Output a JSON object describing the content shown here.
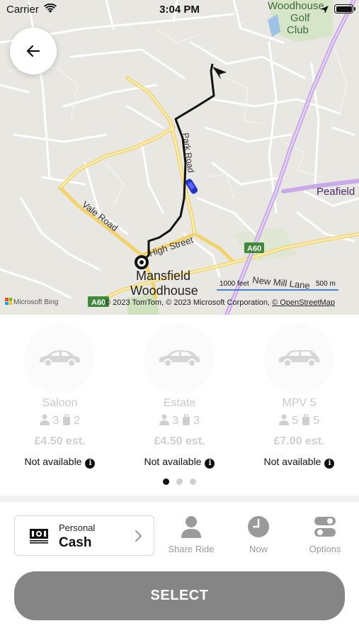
{
  "status_bar": {
    "carrier": "Carrier",
    "time": "3:04 PM"
  },
  "map": {
    "labels": {
      "golf_club_line1": "Woodhouse",
      "golf_club_line2": "Golf",
      "golf_club_line3": "Club",
      "peafield": "Peafield",
      "vale_road": "Vale Road",
      "high_street": "High Street",
      "park_road": "Park Road",
      "a60_upper": "A60",
      "a60_lower": "A60",
      "town_line1": "Mansfield",
      "town_line2": "Woodhouse",
      "new_mill_lane": "New Mill Lane"
    },
    "scale_feet": "1000 feet",
    "scale_meters": "500 m",
    "bing": "Microsoft Bing",
    "attribution_main": "© 2023 TomTom, © 2023 Microsoft Corporation, ",
    "attribution_osm": "© OpenStreetMap",
    "colors": {
      "route": "#111111",
      "main_road": "#f2d36b",
      "highway": "#c9a9e8",
      "driver": "#2233cc"
    }
  },
  "vehicles": [
    {
      "name": "Saloon",
      "passengers": "3",
      "luggage": "2",
      "price": "£4.50 est.",
      "status": "Not available"
    },
    {
      "name": "Estate",
      "passengers": "3",
      "luggage": "3",
      "price": "£4.50 est.",
      "status": "Not available"
    },
    {
      "name": "MPV 5",
      "passengers": "5",
      "luggage": "5",
      "price": "£7.00 est.",
      "status": "Not available"
    }
  ],
  "pagination": {
    "total": 3,
    "active": 1
  },
  "payment": {
    "label": "Personal",
    "value": "Cash"
  },
  "actions": [
    {
      "label": "Share Ride",
      "icon": "person-icon"
    },
    {
      "label": "Now",
      "icon": "clock-icon"
    },
    {
      "label": "Options",
      "icon": "toggles-icon"
    }
  ],
  "select_button": "SELECT"
}
